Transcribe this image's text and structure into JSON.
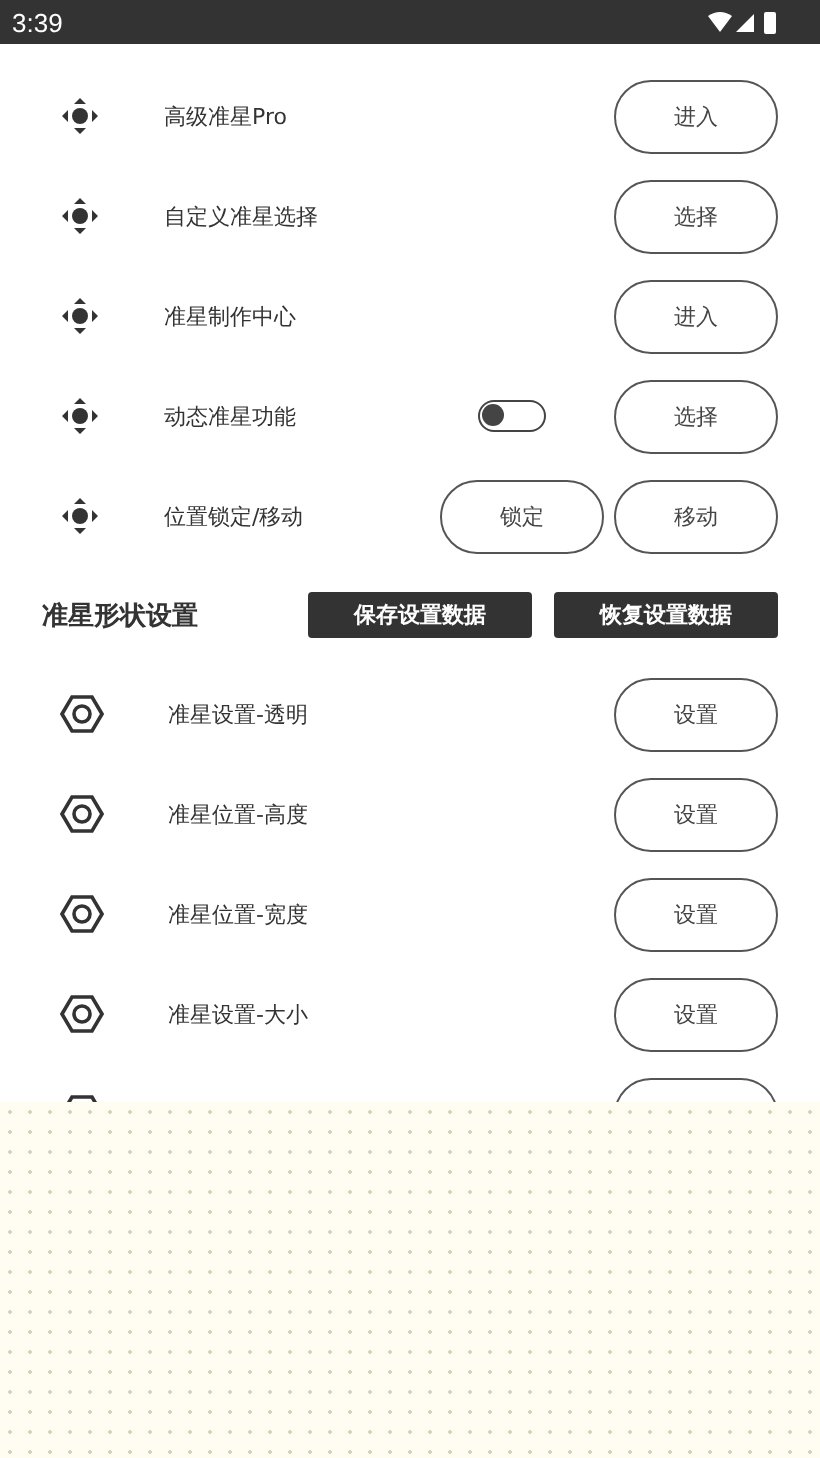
{
  "status_bar": {
    "time": "3:39"
  },
  "control_rows": [
    {
      "kind": "buttons",
      "label": "高级准星Pro",
      "buttons": [
        "进入"
      ]
    },
    {
      "kind": "buttons",
      "label": "自定义准星选择",
      "buttons": [
        "选择"
      ]
    },
    {
      "kind": "buttons",
      "label": "准星制作中心",
      "buttons": [
        "进入"
      ]
    },
    {
      "kind": "toggle",
      "label": "动态准星功能",
      "on": false,
      "buttons": [
        "选择"
      ]
    },
    {
      "kind": "buttons",
      "label": "位置锁定/移动",
      "buttons": [
        "锁定",
        "移动"
      ]
    }
  ],
  "shape_section": {
    "title": "准星形状设置",
    "actions": [
      "保存设置数据",
      "恢复设置数据"
    ]
  },
  "shape_rows": [
    {
      "label": "准星设置-透明",
      "button": "设置"
    },
    {
      "label": "准星位置-高度",
      "button": "设置"
    },
    {
      "label": "准星位置-宽度",
      "button": "设置"
    },
    {
      "label": "准星设置-大小",
      "button": "设置"
    }
  ]
}
